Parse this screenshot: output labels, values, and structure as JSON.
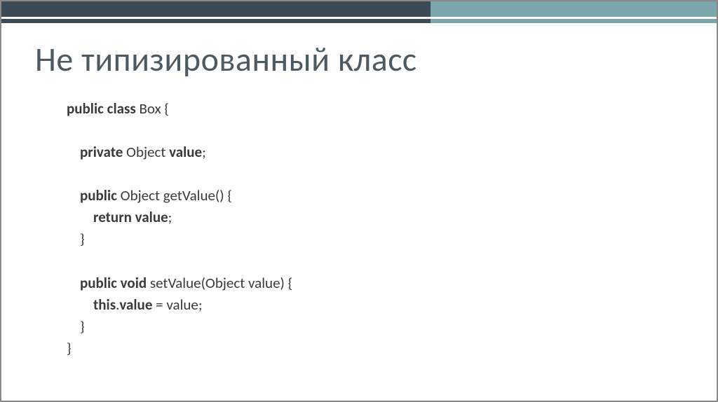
{
  "title": "Не типизированный класс",
  "code": {
    "line1_kw": "public class",
    "line1_rest": " Box {",
    "line2_kw": "private",
    "line2_mid": " Object ",
    "line2_kw2": "value",
    "line2_rest": ";",
    "line3_kw": "public",
    "line3_rest": " Object getValue() {",
    "line4_kw": "return value",
    "line4_rest": ";",
    "line5": "}",
    "line6_kw": "public void",
    "line6_rest": " setValue(Object value) {",
    "line7_kw": "this",
    "line7_mid": ".",
    "line7_kw2": "value",
    "line7_rest": " = value;",
    "line8": "}",
    "line9": "}"
  }
}
